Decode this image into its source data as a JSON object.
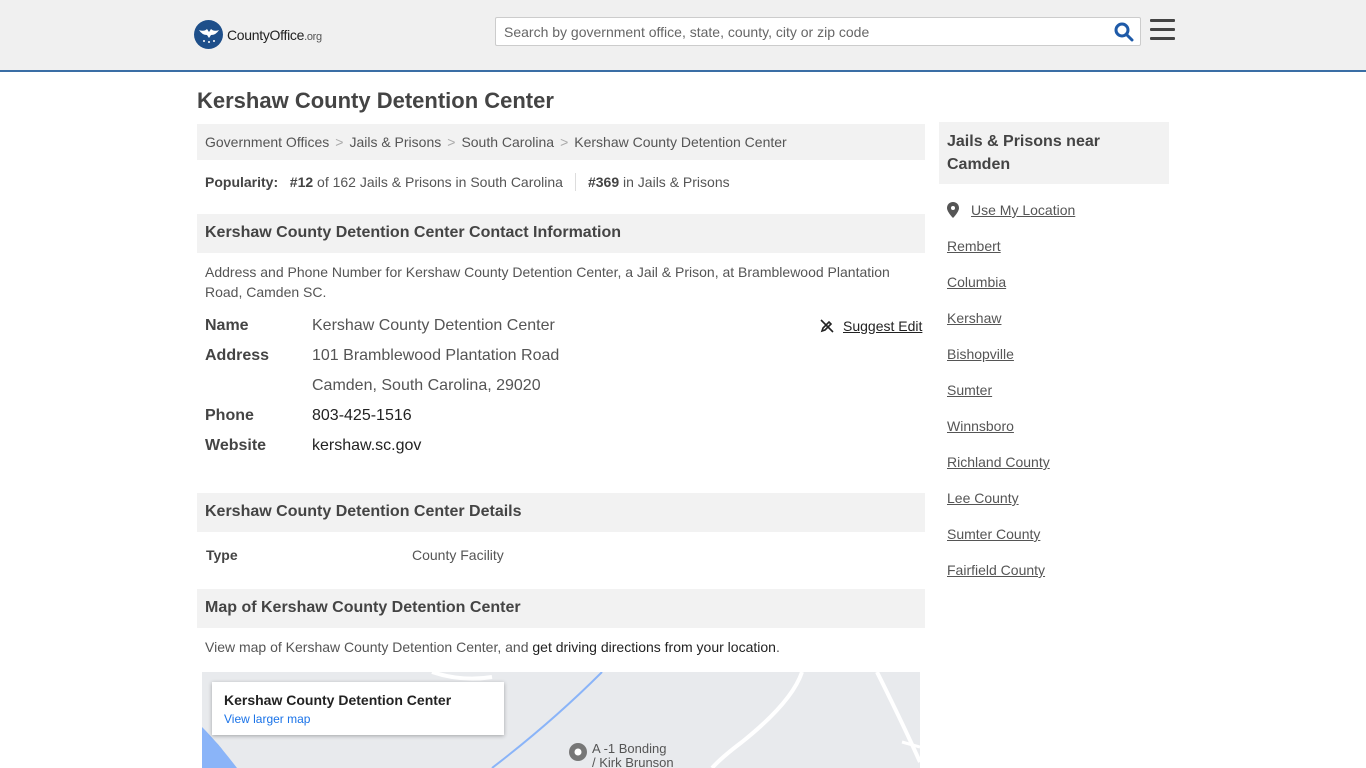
{
  "header": {
    "logo_main": "CountyOffice",
    "logo_tld": ".org",
    "search_placeholder": "Search by government office, state, county, city or zip code"
  },
  "page_title": "Kershaw County Detention Center",
  "breadcrumb": [
    "Government Offices",
    "Jails & Prisons",
    "South Carolina",
    "Kershaw County Detention Center"
  ],
  "popularity": {
    "label": "Popularity:",
    "state_rank": "#12",
    "state_text": "of 162 Jails & Prisons in South Carolina",
    "national_rank": "#369",
    "national_text": "in Jails & Prisons"
  },
  "contact": {
    "heading": "Kershaw County Detention Center Contact Information",
    "description": "Address and Phone Number for Kershaw County Detention Center, a Jail & Prison, at Bramblewood Plantation Road, Camden SC.",
    "name_label": "Name",
    "name": "Kershaw County Detention Center",
    "address_label": "Address",
    "address_line1": "101 Bramblewood Plantation Road",
    "address_line2": "Camden, South Carolina, 29020",
    "phone_label": "Phone",
    "phone": "803-425-1516",
    "website_label": "Website",
    "website": "kershaw.sc.gov",
    "suggest_edit": "Suggest Edit"
  },
  "details": {
    "heading": "Kershaw County Detention Center Details",
    "type_label": "Type",
    "type_value": "County Facility"
  },
  "map": {
    "heading": "Map of Kershaw County Detention Center",
    "desc_prefix": "View map of Kershaw County Detention Center, and ",
    "desc_link": "get driving directions from your location",
    "desc_suffix": ".",
    "card_title": "Kershaw County Detention Center",
    "card_link": "View larger map",
    "pin_label_1": "A -1 Bonding",
    "pin_label_2": "/ Kirk Brunson"
  },
  "sidebar": {
    "heading_line1": "Jails & Prisons near",
    "heading_line2": "Camden",
    "use_location": "Use My Location",
    "links": [
      "Rembert",
      "Columbia",
      "Kershaw",
      "Bishopville",
      "Sumter",
      "Winnsboro",
      "Richland County",
      "Lee County",
      "Sumter County",
      "Fairfield County"
    ]
  },
  "colors": {
    "header_bg": "#f0f0f0",
    "header_border": "#3a6ea5",
    "logo_blue": "#1e4f8a",
    "search_icon": "#1e5aa8",
    "map_link": "#1a73e8"
  }
}
